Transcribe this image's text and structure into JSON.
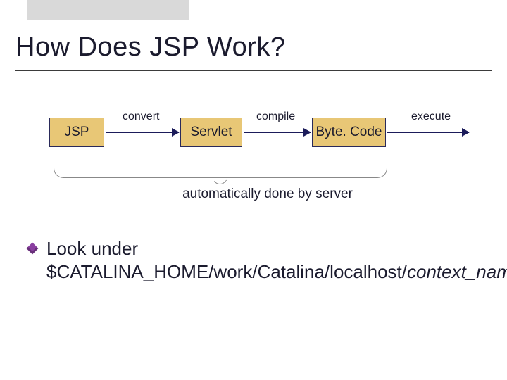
{
  "title": "How Does JSP Work?",
  "diagram": {
    "nodes": {
      "jsp": "JSP",
      "servlet": "Servlet",
      "bytecode": "Byte. Code"
    },
    "edges": {
      "convert": "convert",
      "compile": "compile",
      "execute": "execute"
    },
    "brace_caption": "automatically done by server"
  },
  "bullet": {
    "line": "Look under $CATALINA_HOME/work/Catalina/localhost/",
    "italic_tail": "context_name"
  }
}
